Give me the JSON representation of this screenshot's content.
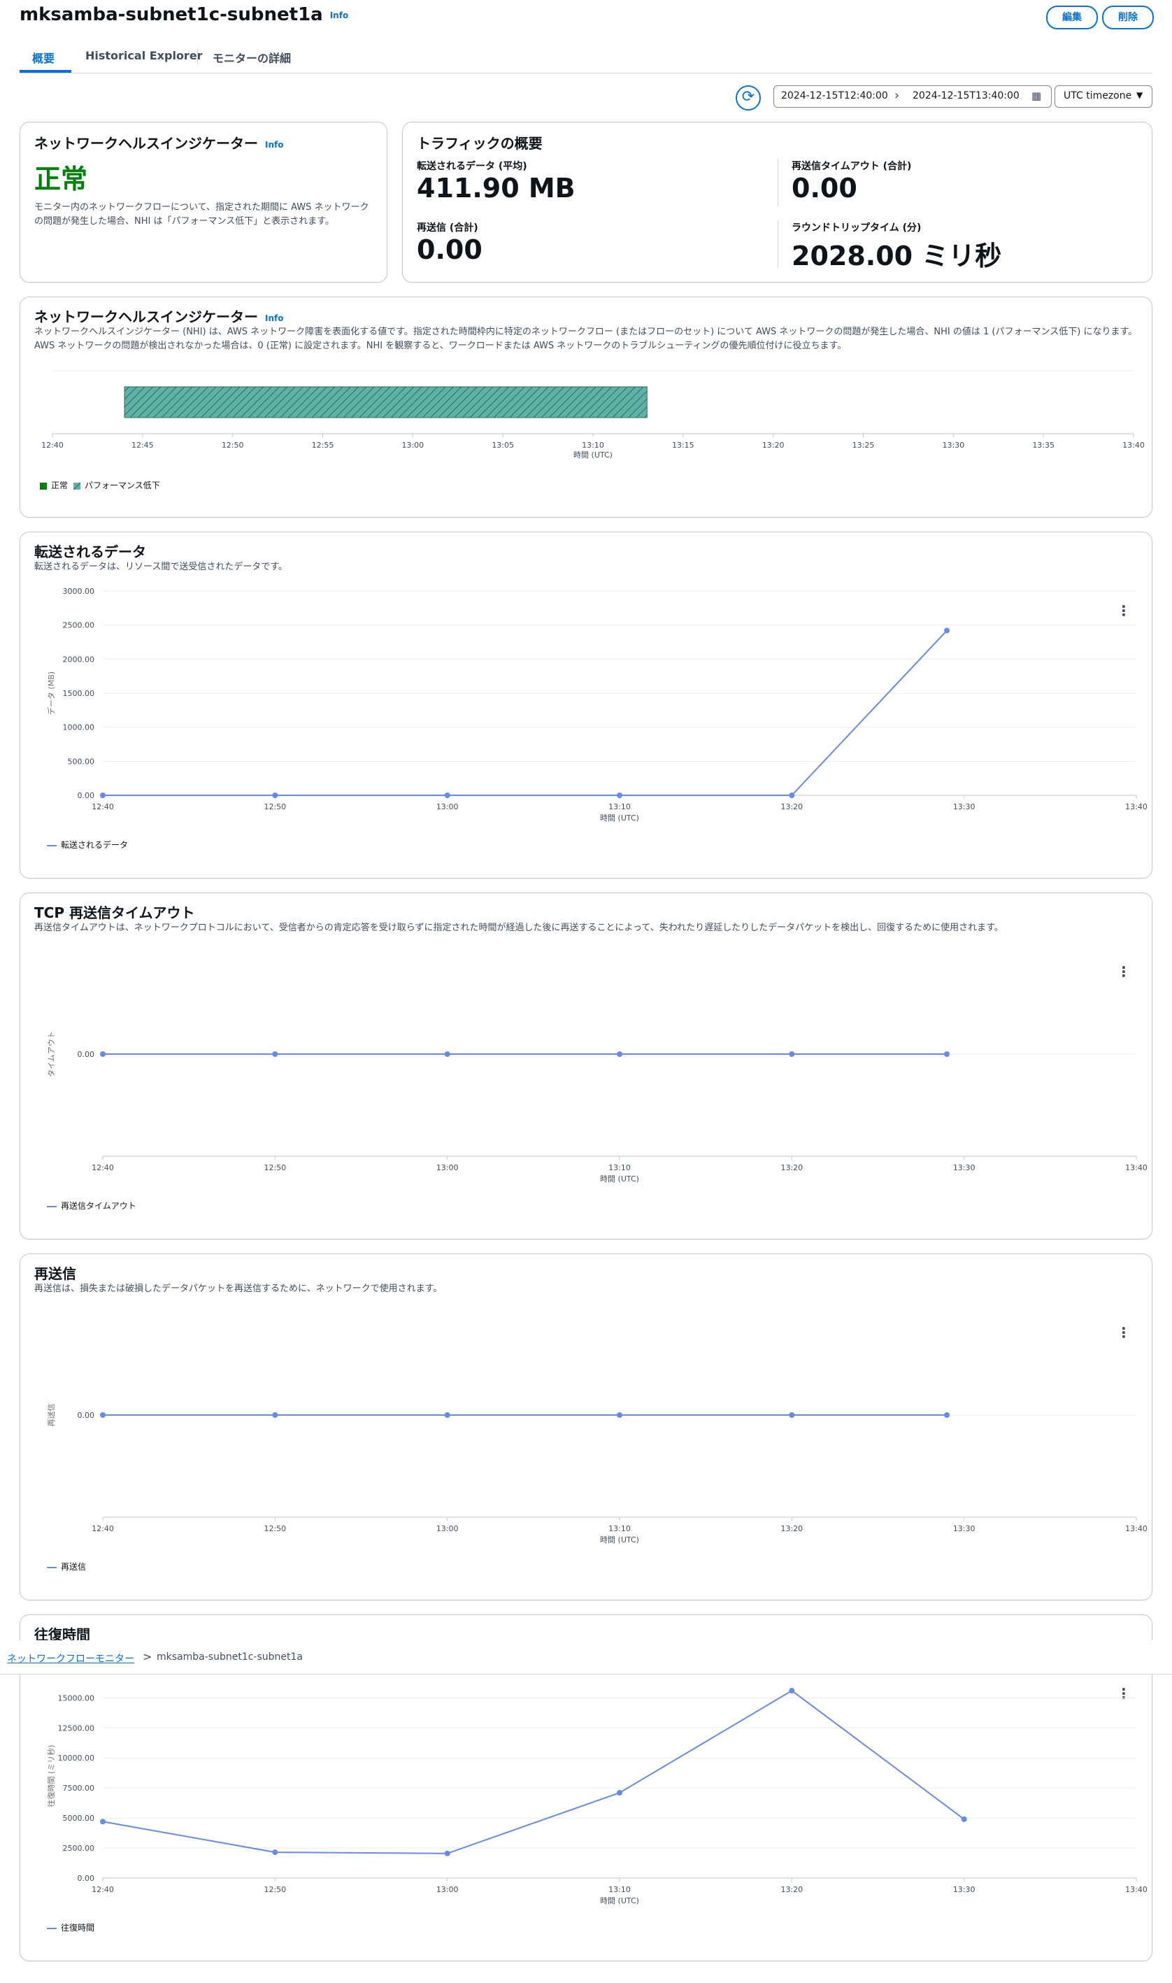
{
  "header": {
    "title": "mksamba-subnet1c-subnet1a",
    "info": "Info",
    "edit_button": "編集",
    "delete_button": "削除"
  },
  "tabs": [
    {
      "label": "概要",
      "active": true
    },
    {
      "label": "Historical Explorer",
      "active": false
    },
    {
      "label": "モニターの詳細",
      "active": false
    }
  ],
  "toolbar": {
    "start": "2024-12-15T12:40:00",
    "end": "2024-12-15T13:40:00",
    "timezone": "UTC timezone"
  },
  "nhi_status": {
    "title": "ネットワークヘルスインジケーター",
    "info": "Info",
    "status": "正常",
    "status_color": "#037f0c",
    "description": "モニター内のネットワークフローについて、指定された期間に AWS ネットワークの問題が発生した場合、NHI は「パフォーマンス低下」と表示されます。"
  },
  "traffic": {
    "title": "トラフィックの概要",
    "metrics": [
      {
        "label": "転送されるデータ (平均)",
        "value": "411.90 MB"
      },
      {
        "label": "再送信タイムアウト (合計)",
        "value": "0.00"
      },
      {
        "label": "再送信 (合計)",
        "value": "0.00"
      },
      {
        "label": "ラウンドトリップタイム (分)",
        "value": "2028.00 ミリ秒"
      }
    ]
  },
  "nhi_chart": {
    "title": "ネットワークヘルスインジケーター",
    "info": "Info",
    "description": "ネットワークヘルスインジケーター (NHI) は、AWS ネットワーク障害を表面化する値です。指定された時間枠内に特定のネットワークフロー (またはフローのセット) について AWS ネットワークの問題が発生した場合、NHI の値は 1 (パフォーマンス低下) になります。AWS ネットワークの問題が検出されなかった場合は、0 (正常) に設定されます。NHI を観察すると、ワークロードまたは AWS ネットワークのトラブルシューティングの優先順位付けに役立ちます。",
    "xlabel": "時間 (UTC)",
    "ticks": [
      "12:40",
      "12:45",
      "12:50",
      "12:55",
      "13:00",
      "13:05",
      "13:10",
      "13:15",
      "13:20",
      "13:25",
      "13:30",
      "13:35",
      "13:40"
    ],
    "legend": [
      "正常",
      "パフォーマンス低下"
    ],
    "colors": {
      "normal": "#037f0c",
      "degraded": "#3d9a8e"
    }
  },
  "chart_data": [
    {
      "type": "timeline",
      "xlabel": "時間 (UTC)",
      "xlim": [
        "12:40",
        "13:40"
      ],
      "segments": [
        {
          "start": "12:44",
          "end": "13:13",
          "state": "パフォーマンス低下"
        }
      ]
    },
    {
      "type": "line",
      "title": "転送されるデータ",
      "subtitle": "転送されるデータは、リソース間で送受信されたデータです。",
      "xlabel": "時間 (UTC)",
      "ylabel": "データ (MB)",
      "x_ticks": [
        "12:40",
        "12:50",
        "13:00",
        "13:10",
        "13:20",
        "13:30",
        "13:40"
      ],
      "y_ticks": [
        "0.00",
        "500.00",
        "1000.00",
        "1500.00",
        "2000.00",
        "2500.00",
        "3000.00"
      ],
      "ylim": [
        0,
        3000
      ],
      "series": [
        {
          "name": "転送されるデータ",
          "x": [
            0,
            10,
            20,
            30,
            40,
            49
          ],
          "values": [
            0,
            0,
            0,
            0,
            0,
            2420
          ]
        }
      ]
    },
    {
      "type": "line",
      "title": "TCP 再送信タイムアウト",
      "subtitle": "再送信タイムアウトは、ネットワークプロトコルにおいて、受信者からの肯定応答を受け取らずに指定された時間が経過した後に再送することによって、失われたり遅延したりしたデータパケットを検出し、回復するために使用されます。",
      "xlabel": "時間 (UTC)",
      "ylabel": "タイムアウト",
      "x_ticks": [
        "12:40",
        "12:50",
        "13:00",
        "13:10",
        "13:20",
        "13:30",
        "13:40"
      ],
      "y_ticks": [
        "0.00"
      ],
      "series": [
        {
          "name": "再送信タイムアウト",
          "x": [
            0,
            10,
            20,
            30,
            40,
            49
          ],
          "values": [
            0,
            0,
            0,
            0,
            0,
            0
          ]
        }
      ]
    },
    {
      "type": "line",
      "title": "再送信",
      "subtitle": "再送信は、損失または破損したデータパケットを再送信するために、ネットワークで使用されます。",
      "xlabel": "時間 (UTC)",
      "ylabel": "再送信",
      "x_ticks": [
        "12:40",
        "12:50",
        "13:00",
        "13:10",
        "13:20",
        "13:30",
        "13:40"
      ],
      "y_ticks": [
        "0.00"
      ],
      "series": [
        {
          "name": "再送信",
          "x": [
            0,
            10,
            20,
            30,
            40,
            49
          ],
          "values": [
            0,
            0,
            0,
            0,
            0,
            0
          ]
        }
      ]
    },
    {
      "type": "line",
      "title": "往復時間",
      "xlabel": "時間 (UTC)",
      "ylabel": "往復時間 (ミリ秒)",
      "x_ticks": [
        "12:40",
        "12:50",
        "13:00",
        "13:10",
        "13:20",
        "13:30",
        "13:40"
      ],
      "y_ticks": [
        "0.00",
        "2500.00",
        "5000.00",
        "7500.00",
        "10000.00",
        "12500.00",
        "15000.00"
      ],
      "ylim": [
        0,
        17000
      ],
      "series": [
        {
          "name": "往復時間",
          "x": [
            0,
            10,
            20,
            30,
            40,
            50
          ],
          "values": [
            4700,
            2150,
            2050,
            7100,
            15600,
            4900
          ]
        }
      ]
    }
  ],
  "breadcrumb": {
    "parent": "ネットワークフローモニター",
    "separator": ">",
    "current": "mksamba-subnet1c-subnet1a"
  },
  "colors": {
    "accent": "#0972d3",
    "line": "#688ae8"
  }
}
